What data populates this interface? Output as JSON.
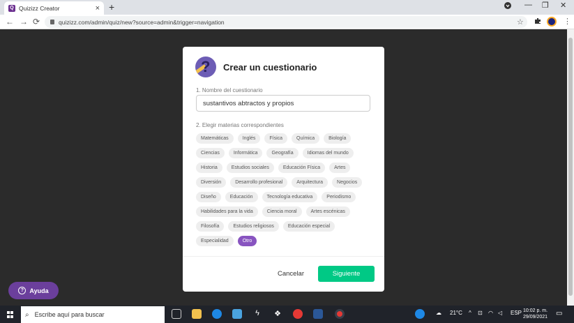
{
  "browser": {
    "tab_title": "Quizizz Creator",
    "tab_close": "×",
    "new_tab": "+",
    "url": "quizizz.com/admin/quiz/new?source=admin&trigger=navigation",
    "back": "←",
    "forward": "→",
    "reload": "⟳",
    "star": "☆",
    "menu": "⋮",
    "minimize": "—",
    "restore": "❐",
    "close": "✕"
  },
  "modal": {
    "title": "Crear un cuestionario",
    "name_label": "1. Nombre del cuestionario",
    "name_value": "sustantivos abtractos y propios",
    "subjects_label": "2. Elegir materias correspondientes",
    "subject_rows": [
      [
        "Matemáticas",
        "Inglés",
        "Física",
        "Química",
        "Biología"
      ],
      [
        "Ciencias",
        "Informática",
        "Geografía",
        "Idiomas del mundo"
      ],
      [
        "Historia",
        "Estudios sociales",
        "Educación Física",
        "Artes"
      ],
      [
        "Diversión",
        "Desarrollo profesional",
        "Arquitectura",
        "Negocios"
      ],
      [
        "Diseño",
        "Educación",
        "Tecnología educativa",
        "Periodismo"
      ],
      [
        "Habilidades para la vida",
        "Ciencia moral",
        "Artes escénicas"
      ],
      [
        "Filosofía",
        "Estudios religiosos",
        "Educación especial"
      ],
      [
        "Especialidad",
        "Otro"
      ]
    ],
    "selected_subject": "Otro",
    "cancel_label": "Cancelar",
    "next_label": "Siguiente"
  },
  "help": {
    "label": "Ayuda"
  },
  "taskbar": {
    "search_placeholder": "Escribe aquí para buscar",
    "weather": "21°C",
    "language": "ESP",
    "time": "10:02 p. m.",
    "date": "29/09/2021"
  },
  "colors": {
    "accent_purple": "#8854c0",
    "next_green": "#00c985",
    "help_purple": "#6b3f9c"
  }
}
